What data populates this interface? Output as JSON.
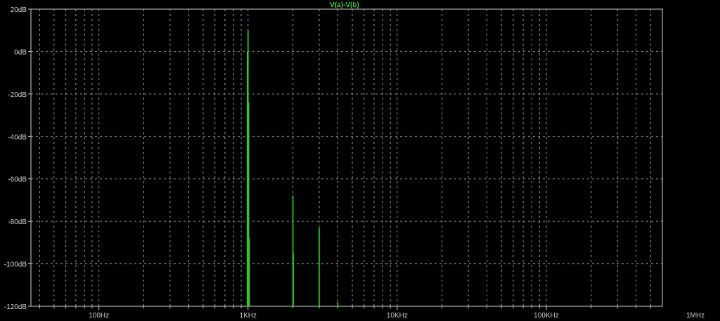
{
  "colors": {
    "background": "#000000",
    "frame": "#c8c8c8",
    "grid": "#8a8a8a",
    "tick_text": "#c8c8c8",
    "trace": "#1fcf1f"
  },
  "chart_data": {
    "type": "line",
    "title": "V(a)-V(b)",
    "xlabel": "",
    "ylabel": "",
    "xscale": "log",
    "xlim": [
      35,
      600000
    ],
    "ylim": [
      -120,
      20
    ],
    "grid": true,
    "x_ticks": [
      {
        "value": 100,
        "label": "100Hz"
      },
      {
        "value": 1000,
        "label": "1KHz"
      },
      {
        "value": 10000,
        "label": "10KHz"
      },
      {
        "value": 100000,
        "label": "100KHz"
      },
      {
        "value": 1000000,
        "label": "1MHz"
      }
    ],
    "y_ticks": [
      {
        "value": 20,
        "label": "20dB"
      },
      {
        "value": 0,
        "label": "0dB"
      },
      {
        "value": -20,
        "label": "-20dB"
      },
      {
        "value": -40,
        "label": "-40dB"
      },
      {
        "value": -60,
        "label": "-60dB"
      },
      {
        "value": -80,
        "label": "-80dB"
      },
      {
        "value": -100,
        "label": "-100dB"
      },
      {
        "value": -120,
        "label": "-120dB"
      }
    ],
    "series": [
      {
        "name": "V(a)-V(b)",
        "peaks": [
          {
            "x": 990,
            "y": 0,
            "floor": -120
          },
          {
            "x": 1000,
            "y": 10,
            "floor": -120
          },
          {
            "x": 1010,
            "y": -24,
            "floor": -120
          },
          {
            "x": 1020,
            "y": -88,
            "floor": -120
          },
          {
            "x": 2000,
            "y": -68,
            "floor": -120
          },
          {
            "x": 2010,
            "y": -95,
            "floor": -120
          },
          {
            "x": 3000,
            "y": -83,
            "floor": -120
          },
          {
            "x": 4000,
            "y": -118,
            "floor": -120
          }
        ]
      }
    ]
  }
}
